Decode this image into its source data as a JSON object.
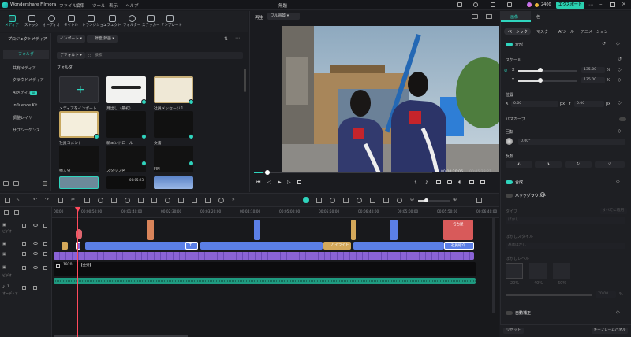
{
  "app": {
    "title": "Wondershare Filmora",
    "project": "無題",
    "menus": [
      "ファイル",
      "編集",
      "ツール",
      "表示",
      "ヘルプ"
    ],
    "credits": "2400",
    "export_label": "エクスポート"
  },
  "toolbar": {
    "tabs": [
      {
        "label": "メディア",
        "icon": "media-icon"
      },
      {
        "label": "ストック",
        "icon": "stock-icon"
      },
      {
        "label": "オーディオ",
        "icon": "music-icon"
      },
      {
        "label": "タイトル",
        "icon": "title-icon"
      },
      {
        "label": "トランジション",
        "icon": "transition-icon"
      },
      {
        "label": "エフェクト",
        "icon": "effect-icon"
      },
      {
        "label": "フィルター",
        "icon": "filter-icon"
      },
      {
        "label": "ステッカー",
        "icon": "sticker-icon"
      },
      {
        "label": "テンプレート",
        "icon": "template-icon"
      }
    ]
  },
  "leftnav": {
    "items": [
      "プロジェクトメディア",
      "フォルダ",
      "共有メディア",
      "クラウドメディア",
      "AIメディア",
      "Influence Kit",
      "調整レイヤー",
      "サブシーケンス"
    ],
    "ai_badge": "AI"
  },
  "media": {
    "import_label": "インポート",
    "record_label": "録音/録画",
    "default_label": "デフォルト",
    "search_placeholder": "検索",
    "folder_label": "フォルダ",
    "items": [
      {
        "label": "メディアをインポート"
      },
      {
        "label": "見出し（最初）"
      },
      {
        "label": "社員メッセージ１"
      },
      {
        "label": "社員コメント"
      },
      {
        "label": "新エンドロール"
      },
      {
        "label": "文書"
      },
      {
        "label": "挿入分"
      },
      {
        "label": "スタッフ名"
      },
      {
        "label": "FIN"
      }
    ],
    "duration_label": "00:05:23"
  },
  "preview": {
    "mode": "再生",
    "quality": "フル画質",
    "current_time": "00:00:20:06",
    "total_time": "00:05:28:21"
  },
  "props": {
    "tabs": [
      "画像",
      "色"
    ],
    "subtabs": [
      "ベーシック",
      "マスク",
      "AIツール",
      "アニメーション"
    ],
    "transform_label": "変形",
    "scale_label": "スケール",
    "x_label": "X",
    "y_label": "Y",
    "scale_x": "135.00",
    "scale_y": "135.00",
    "unit_pct": "%",
    "position_label": "位置",
    "pos_x": "0.00",
    "pos_y": "0.00",
    "unit_px": "px",
    "path_curve_label": "パスカーブ",
    "rotate_label": "回転",
    "rotate_value": "0.00°",
    "flip_label": "反転",
    "composite_label": "合成",
    "background_label": "バックグラウンド",
    "type_label": "タイプ",
    "type_value": "ぼかし",
    "type_action": "すべてに適用",
    "blur_style_label": "ぼかしスタイル",
    "blur_style_value": "基本ぼかし",
    "blur_level_label": "ぼかしレベル",
    "blur_levels": [
      "20%",
      "40%",
      "60%"
    ],
    "blur_value": "70.00",
    "unit_pct2": "%",
    "auto_correct_label": "自動補正",
    "reset_label": "リセット",
    "keyframe_label": "キーフレームパネル"
  },
  "timeline": {
    "ruler_ticks": [
      "00:00",
      "00:00:50:00",
      "00:01:40:00",
      "00:02:30:00",
      "00:03:20:00",
      "00:04:10:00",
      "00:05:00:00",
      "00:05:50:00",
      "00:06:40:00"
    ],
    "track_labels": [
      "ビデオ",
      "ビデオ",
      "オーディオ"
    ],
    "clip_labels": [
      "1920",
      "【全労】",
      "ハイライト",
      "社員紹介",
      "名古屋"
    ],
    "track_number": "1"
  }
}
